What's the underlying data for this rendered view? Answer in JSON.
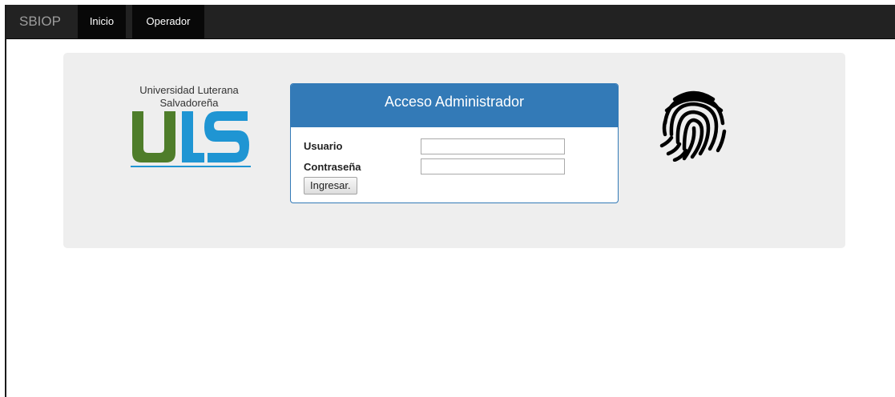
{
  "navbar": {
    "brand": "SBIOP",
    "items": [
      {
        "label": "Inicio"
      },
      {
        "label": "Operador"
      }
    ]
  },
  "logo": {
    "title_line1": "Universidad Luterana",
    "title_line2": "Salvadoreña",
    "colors": {
      "green": "#4e7d2a",
      "blue": "#1f95d3"
    }
  },
  "login_panel": {
    "title": "Acceso Administrador",
    "username_label": "Usuario",
    "username_value": "",
    "password_label": "Contraseña",
    "password_value": "",
    "submit_label": "Ingresar."
  },
  "colors": {
    "navbar_bg": "#222222",
    "panel_primary": "#337ab7",
    "jumbotron_bg": "#eeeeee"
  },
  "icons": {
    "fingerprint": "fingerprint-icon"
  }
}
